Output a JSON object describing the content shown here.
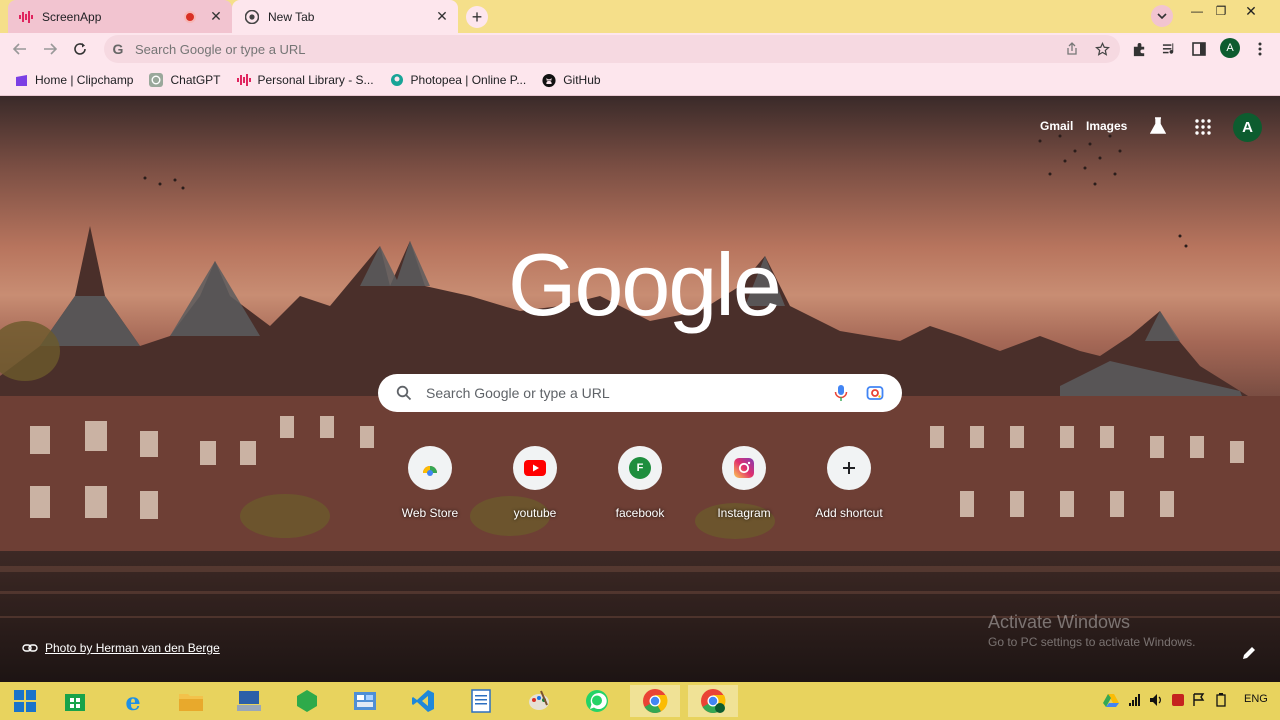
{
  "tabs": [
    {
      "title": "ScreenApp",
      "recording": true
    },
    {
      "title": "New Tab"
    }
  ],
  "omnibox": {
    "placeholder": "Search Google or type a URL",
    "avatar_letter": "A"
  },
  "bookmarks": [
    {
      "label": "Home | Clipchamp",
      "icon": "clipchamp-icon"
    },
    {
      "label": "ChatGPT",
      "icon": "chatgpt-icon"
    },
    {
      "label": "Personal Library - S...",
      "icon": "screenapp-icon"
    },
    {
      "label": "Photopea | Online P...",
      "icon": "photopea-icon"
    },
    {
      "label": "GitHub",
      "icon": "github-icon"
    }
  ],
  "ntp": {
    "top_links": {
      "gmail": "Gmail",
      "images": "Images"
    },
    "avatar_letter": "A",
    "logo": "Google",
    "search_placeholder": "Search Google or type a URL",
    "shortcuts": [
      {
        "label": "Web Store",
        "icon": "webstore-icon"
      },
      {
        "label": "youtube",
        "icon": "youtube-icon"
      },
      {
        "label": "facebook",
        "icon": "facebook-icon",
        "letter": "F"
      },
      {
        "label": "Instagram",
        "icon": "instagram-icon"
      },
      {
        "label": "Add shortcut",
        "icon": "plus-icon"
      }
    ],
    "photo_credit": "Photo by Herman van den Berge",
    "activation": {
      "title": "Activate Windows",
      "subtitle": "Go to PC settings to activate Windows."
    }
  },
  "taskbar": {
    "tray_language": "ENG"
  },
  "colors": {
    "tabstrip": "#f5df8a",
    "toolbar": "#fde6ed",
    "taskbar": "#e8d35e",
    "avatar": "#0d5c2f"
  }
}
